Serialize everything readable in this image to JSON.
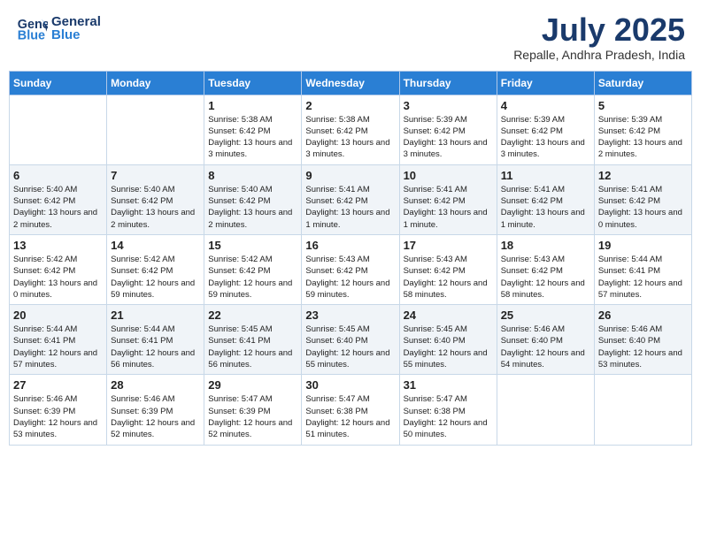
{
  "header": {
    "logo_line1": "General",
    "logo_line2": "Blue",
    "month_year": "July 2025",
    "location": "Repalle, Andhra Pradesh, India"
  },
  "weekdays": [
    "Sunday",
    "Monday",
    "Tuesday",
    "Wednesday",
    "Thursday",
    "Friday",
    "Saturday"
  ],
  "weeks": [
    [
      {
        "day": "",
        "info": ""
      },
      {
        "day": "",
        "info": ""
      },
      {
        "day": "1",
        "info": "Sunrise: 5:38 AM\nSunset: 6:42 PM\nDaylight: 13 hours and 3 minutes."
      },
      {
        "day": "2",
        "info": "Sunrise: 5:38 AM\nSunset: 6:42 PM\nDaylight: 13 hours and 3 minutes."
      },
      {
        "day": "3",
        "info": "Sunrise: 5:39 AM\nSunset: 6:42 PM\nDaylight: 13 hours and 3 minutes."
      },
      {
        "day": "4",
        "info": "Sunrise: 5:39 AM\nSunset: 6:42 PM\nDaylight: 13 hours and 3 minutes."
      },
      {
        "day": "5",
        "info": "Sunrise: 5:39 AM\nSunset: 6:42 PM\nDaylight: 13 hours and 2 minutes."
      }
    ],
    [
      {
        "day": "6",
        "info": "Sunrise: 5:40 AM\nSunset: 6:42 PM\nDaylight: 13 hours and 2 minutes."
      },
      {
        "day": "7",
        "info": "Sunrise: 5:40 AM\nSunset: 6:42 PM\nDaylight: 13 hours and 2 minutes."
      },
      {
        "day": "8",
        "info": "Sunrise: 5:40 AM\nSunset: 6:42 PM\nDaylight: 13 hours and 2 minutes."
      },
      {
        "day": "9",
        "info": "Sunrise: 5:41 AM\nSunset: 6:42 PM\nDaylight: 13 hours and 1 minute."
      },
      {
        "day": "10",
        "info": "Sunrise: 5:41 AM\nSunset: 6:42 PM\nDaylight: 13 hours and 1 minute."
      },
      {
        "day": "11",
        "info": "Sunrise: 5:41 AM\nSunset: 6:42 PM\nDaylight: 13 hours and 1 minute."
      },
      {
        "day": "12",
        "info": "Sunrise: 5:41 AM\nSunset: 6:42 PM\nDaylight: 13 hours and 0 minutes."
      }
    ],
    [
      {
        "day": "13",
        "info": "Sunrise: 5:42 AM\nSunset: 6:42 PM\nDaylight: 13 hours and 0 minutes."
      },
      {
        "day": "14",
        "info": "Sunrise: 5:42 AM\nSunset: 6:42 PM\nDaylight: 12 hours and 59 minutes."
      },
      {
        "day": "15",
        "info": "Sunrise: 5:42 AM\nSunset: 6:42 PM\nDaylight: 12 hours and 59 minutes."
      },
      {
        "day": "16",
        "info": "Sunrise: 5:43 AM\nSunset: 6:42 PM\nDaylight: 12 hours and 59 minutes."
      },
      {
        "day": "17",
        "info": "Sunrise: 5:43 AM\nSunset: 6:42 PM\nDaylight: 12 hours and 58 minutes."
      },
      {
        "day": "18",
        "info": "Sunrise: 5:43 AM\nSunset: 6:42 PM\nDaylight: 12 hours and 58 minutes."
      },
      {
        "day": "19",
        "info": "Sunrise: 5:44 AM\nSunset: 6:41 PM\nDaylight: 12 hours and 57 minutes."
      }
    ],
    [
      {
        "day": "20",
        "info": "Sunrise: 5:44 AM\nSunset: 6:41 PM\nDaylight: 12 hours and 57 minutes."
      },
      {
        "day": "21",
        "info": "Sunrise: 5:44 AM\nSunset: 6:41 PM\nDaylight: 12 hours and 56 minutes."
      },
      {
        "day": "22",
        "info": "Sunrise: 5:45 AM\nSunset: 6:41 PM\nDaylight: 12 hours and 56 minutes."
      },
      {
        "day": "23",
        "info": "Sunrise: 5:45 AM\nSunset: 6:40 PM\nDaylight: 12 hours and 55 minutes."
      },
      {
        "day": "24",
        "info": "Sunrise: 5:45 AM\nSunset: 6:40 PM\nDaylight: 12 hours and 55 minutes."
      },
      {
        "day": "25",
        "info": "Sunrise: 5:46 AM\nSunset: 6:40 PM\nDaylight: 12 hours and 54 minutes."
      },
      {
        "day": "26",
        "info": "Sunrise: 5:46 AM\nSunset: 6:40 PM\nDaylight: 12 hours and 53 minutes."
      }
    ],
    [
      {
        "day": "27",
        "info": "Sunrise: 5:46 AM\nSunset: 6:39 PM\nDaylight: 12 hours and 53 minutes."
      },
      {
        "day": "28",
        "info": "Sunrise: 5:46 AM\nSunset: 6:39 PM\nDaylight: 12 hours and 52 minutes."
      },
      {
        "day": "29",
        "info": "Sunrise: 5:47 AM\nSunset: 6:39 PM\nDaylight: 12 hours and 52 minutes."
      },
      {
        "day": "30",
        "info": "Sunrise: 5:47 AM\nSunset: 6:38 PM\nDaylight: 12 hours and 51 minutes."
      },
      {
        "day": "31",
        "info": "Sunrise: 5:47 AM\nSunset: 6:38 PM\nDaylight: 12 hours and 50 minutes."
      },
      {
        "day": "",
        "info": ""
      },
      {
        "day": "",
        "info": ""
      }
    ]
  ]
}
